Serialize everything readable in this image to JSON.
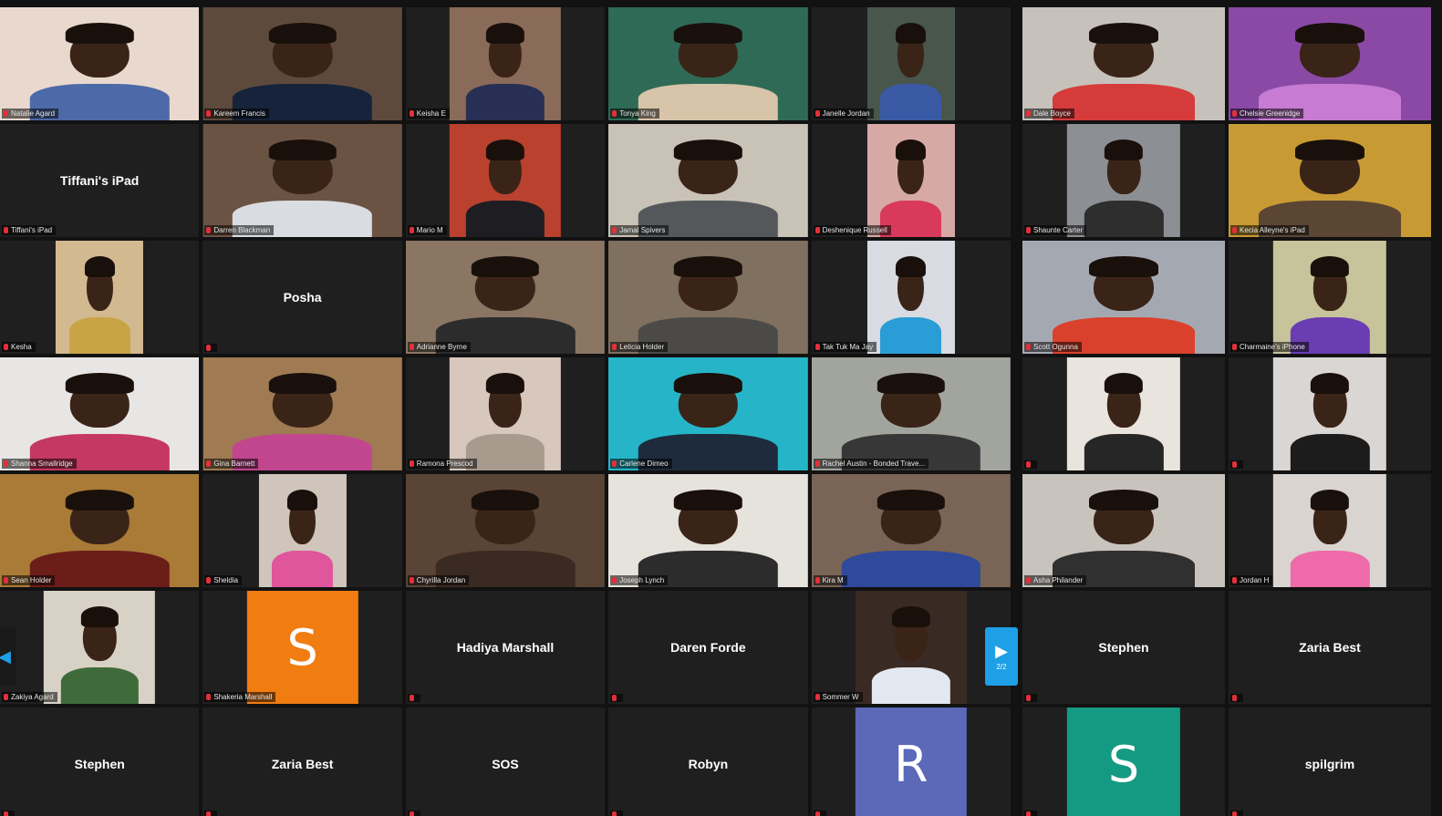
{
  "colors": {
    "background": "#121212",
    "tile": "#1f1f1f",
    "active_speaker": "#d6d35c",
    "muted_mic": "#e2303a",
    "pager": "#1e9fe6"
  },
  "pager": {
    "prev_icon": "chevron-left-icon",
    "next_icon": "chevron-right-icon",
    "next_page": "2/2"
  },
  "left_gallery": [
    {
      "type": "video",
      "label": "Natalie Agard",
      "bg": "#e9d8cd",
      "shirt": "#4c6aa8",
      "width": "full"
    },
    {
      "type": "video",
      "label": "Kareem Francis",
      "bg": "#5e4a3d",
      "shirt": "#16233a",
      "width": "full"
    },
    {
      "type": "video",
      "label": "Keisha E",
      "bg": "#8a6a58",
      "shirt": "#273054",
      "width": "mid"
    },
    {
      "type": "video",
      "label": "Tonya King",
      "bg": "#2f6a56",
      "shirt": "#d8c4a8",
      "width": "full"
    },
    {
      "type": "video",
      "label": "Janelle Jordan",
      "bg": "#48564c",
      "shirt": "#3a5aa6",
      "width": "narrow"
    },
    {
      "type": "name",
      "label": "Tiffani's iPad",
      "name": "Tiffani's iPad"
    },
    {
      "type": "video",
      "label": "Darren Blackman",
      "bg": "#6b5344",
      "shirt": "#d9dde2",
      "width": "full"
    },
    {
      "type": "video",
      "label": "Mario M",
      "bg": "#b9412d",
      "shirt": "#1d1d22",
      "width": "mid"
    },
    {
      "type": "video",
      "label": "Jamal Spivers",
      "bg": "#c9c2b6",
      "shirt": "#55585b",
      "width": "full"
    },
    {
      "type": "video",
      "label": "Deshenique Russell",
      "bg": "#d7a9a6",
      "shirt": "#d9395a",
      "width": "narrow"
    },
    {
      "type": "video",
      "label": "Kesha",
      "bg": "#d2b98f",
      "shirt": "#c8a447",
      "width": "narrow"
    },
    {
      "type": "name",
      "label": "",
      "name": "Posha"
    },
    {
      "type": "video",
      "label": "Adrianne Byrne",
      "bg": "#8b7563",
      "shirt": "#2c2c2c",
      "width": "full"
    },
    {
      "type": "video",
      "label": "Leticia Holder",
      "bg": "#7f705f",
      "shirt": "#4b4a48",
      "width": "full"
    },
    {
      "type": "video",
      "label": "Tak Tuk Ma Jay",
      "bg": "#d8dbe1",
      "shirt": "#2a9cd6",
      "width": "narrow"
    },
    {
      "type": "video",
      "label": "Shanna Smallridge",
      "bg": "#e8e6e4",
      "shirt": "#c53863",
      "width": "full"
    },
    {
      "type": "video",
      "label": "Gina Barnett",
      "bg": "#a07a53",
      "shirt": "#c2458f",
      "width": "full"
    },
    {
      "type": "video",
      "label": "Ramona Prescod",
      "bg": "#d8c7bd",
      "shirt": "#a99a8e",
      "width": "mid"
    },
    {
      "type": "video",
      "label": "Carlene Dimeo",
      "bg": "#26b5c8",
      "shirt": "#1d2b3c",
      "width": "full"
    },
    {
      "type": "video",
      "label": "Rachel Austin - Bonded Trave...",
      "bg": "#a2a59e",
      "shirt": "#373737",
      "width": "full"
    },
    {
      "type": "video",
      "label": "Sean Holder",
      "bg": "#a97b36",
      "shirt": "#6b1d18",
      "active": true,
      "width": "full"
    },
    {
      "type": "video",
      "label": "Sheldia",
      "bg": "#cfc5bb",
      "shirt": "#e0559c",
      "width": "narrow"
    },
    {
      "type": "video",
      "label": "Chyrilla Jordan",
      "bg": "#5a4435",
      "shirt": "#3b2a22",
      "width": "full"
    },
    {
      "type": "video",
      "label": "Joseph Lynch",
      "bg": "#e6e2dc",
      "shirt": "#2c2c2c",
      "width": "full"
    },
    {
      "type": "video",
      "label": "Kira M",
      "bg": "#7a6455",
      "shirt": "#2f4a9a",
      "width": "full"
    },
    {
      "type": "video",
      "label": "Zakiya Agard",
      "bg": "#d8d2c6",
      "shirt": "#3f6b3a",
      "width": "mid"
    },
    {
      "type": "avatar",
      "label": "Shakeria Marshall",
      "letter": "S",
      "color": "#f07c12"
    },
    {
      "type": "name",
      "label": "",
      "name": "Hadiya Marshall"
    },
    {
      "type": "name",
      "label": "",
      "name": "Daren Forde"
    },
    {
      "type": "video",
      "label": "Sommer W",
      "bg": "#3a2a24",
      "shirt": "#e3e7ef",
      "width": "mid"
    },
    {
      "type": "name",
      "label": "",
      "name": "Stephen"
    },
    {
      "type": "name",
      "label": "",
      "name": "Zaria Best"
    },
    {
      "type": "name",
      "label": "",
      "name": "SOS"
    },
    {
      "type": "name",
      "label": "",
      "name": "Robyn"
    },
    {
      "type": "avatar",
      "label": "",
      "letter": "R",
      "color": "#5b69b8"
    }
  ],
  "right_gallery": [
    {
      "type": "video",
      "label": "Dale Boyce",
      "bg": "#c6c1bb",
      "shirt": "#d63b3b",
      "width": "full"
    },
    {
      "type": "video",
      "label": "Chelsie Greenidge",
      "bg": "#8b49a6",
      "shirt": "#c77bd2",
      "width": "full"
    },
    {
      "type": "video",
      "label": "Shaunte Carter",
      "bg": "#8c8f93",
      "shirt": "#2e2e2e",
      "width": "mid"
    },
    {
      "type": "video",
      "label": "Kecia Alleyne's iPad",
      "bg": "#c89a33",
      "shirt": "#5b4634",
      "width": "full"
    },
    {
      "type": "video",
      "label": "Scott Ogunna",
      "bg": "#a4a9b1",
      "shirt": "#d9412c",
      "width": "full"
    },
    {
      "type": "video",
      "label": "Charmaine's iPhone",
      "bg": "#c7c39a",
      "shirt": "#6a3db2",
      "width": "mid"
    },
    {
      "type": "video",
      "label": "",
      "bg": "#e9e4de",
      "shirt": "#262626",
      "width": "mid"
    },
    {
      "type": "video",
      "label": "",
      "bg": "#d9d6d4",
      "shirt": "#1c1c1c",
      "width": "mid"
    },
    {
      "type": "video",
      "label": "Asha Philander",
      "bg": "#c8c3bd",
      "shirt": "#303030",
      "width": "full"
    },
    {
      "type": "video",
      "label": "Jordan H",
      "bg": "#d9d4d0",
      "shirt": "#ee6aa9",
      "width": "mid"
    },
    {
      "type": "name",
      "label": "",
      "name": "Stephen"
    },
    {
      "type": "name",
      "label": "",
      "name": "Zaria Best"
    },
    {
      "type": "avatar",
      "label": "",
      "letter": "S",
      "color": "#149a82"
    },
    {
      "type": "name",
      "label": "",
      "name": "spilgrim"
    }
  ]
}
